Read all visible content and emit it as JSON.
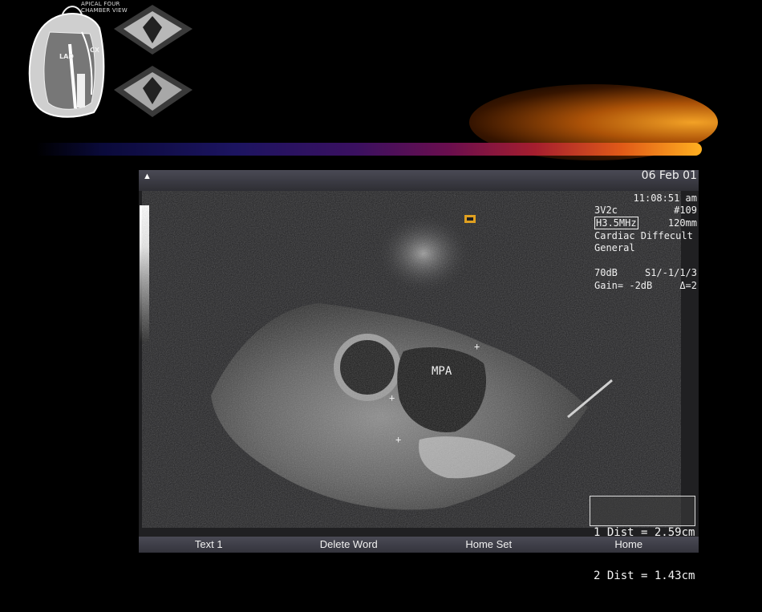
{
  "figure": {
    "caption_line1": "APICAL FOUR",
    "caption_line2": "CHAMBER VIEW",
    "label_lad": "LAD",
    "label_cx": "CX"
  },
  "scan": {
    "date": "06 Feb 01",
    "time": "11:08:51 am",
    "probe": "3V2c",
    "id": "#109",
    "frequency": "H3.5MHz",
    "depth": "120mm",
    "preset1": "Cardiac Diffecult",
    "preset2": "General",
    "dynamic_range": "70dB",
    "settings": "S1/-1/1/3",
    "gain": "Gain= -2dB",
    "delta": "Δ=2",
    "label": "MPA",
    "measure1": "1 Dist = 2.59cm",
    "measure2": "2 Dist = 1.43cm"
  },
  "softkeys": [
    "Text 1",
    "Delete Word",
    "Home Set",
    "Home"
  ],
  "colors": {
    "comet_head": "#ffb020",
    "comet_tail": "#1c1460",
    "screen_bg": "#202022"
  }
}
